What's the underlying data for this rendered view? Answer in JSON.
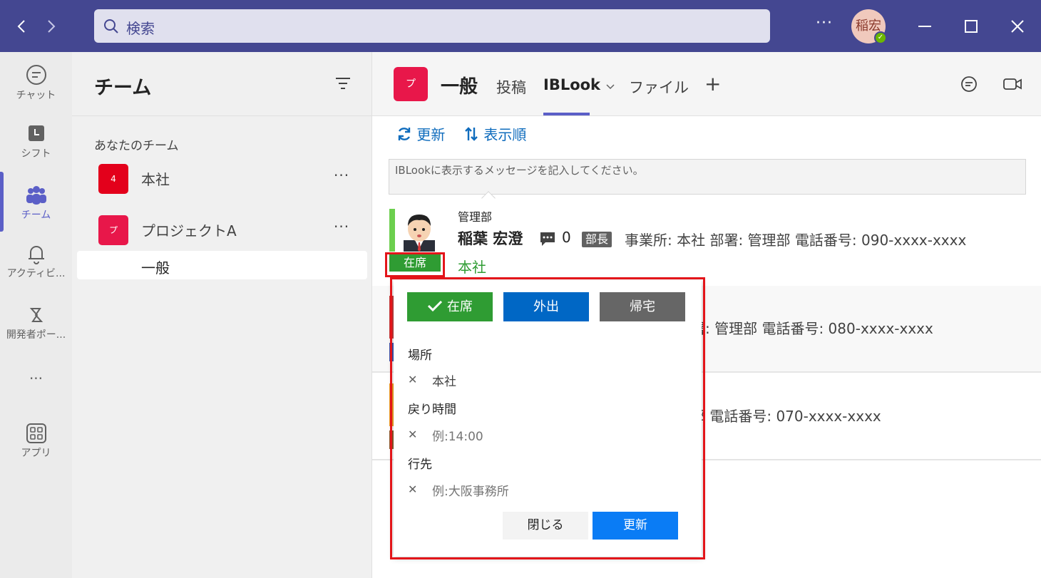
{
  "titlebar": {
    "back_icon": "chevron-left-icon",
    "forward_icon": "chevron-right-icon",
    "search_placeholder": "検索",
    "more_label": "···",
    "avatar_initials": "稲宏",
    "presence_status": "available"
  },
  "rail": {
    "items": [
      {
        "label": "チャット",
        "icon": "chat-icon"
      },
      {
        "label": "シフト",
        "icon": "shifts-icon"
      },
      {
        "label": "チーム",
        "icon": "teams-icon",
        "active": true
      },
      {
        "label": "アクティビ...",
        "icon": "bell-icon"
      },
      {
        "label": "開発者ポー...",
        "icon": "developer-portal-icon"
      },
      {
        "label": "···",
        "icon": "more-icon"
      },
      {
        "label": "アプリ",
        "icon": "apps-icon"
      }
    ]
  },
  "teams_panel": {
    "title": "チーム",
    "section": "あなたのチーム",
    "teams": [
      {
        "name": "本社",
        "tile": "4",
        "color": "#e3001b"
      },
      {
        "name": "プロジェクトA",
        "tile": "プ",
        "color": "#e8174a"
      }
    ],
    "channel": "一般",
    "more": "···"
  },
  "main": {
    "channel_tile": "プ",
    "channel_title": "一般",
    "tabs": [
      "投稿",
      "IBLook",
      "ファイル"
    ],
    "add_tab": "+",
    "toolbar": {
      "refresh": "更新",
      "sort": "表示順"
    },
    "message_placeholder": "IBLookに表示するメッセージを記入してください。",
    "person": {
      "dept": "管理部",
      "name": "稲葉 宏澄",
      "comment_count": "0",
      "title_badge": "部長",
      "info": "事業所: 本社  部署: 管理部  電話番号: 090-xxxx-xxxx",
      "location": "本社",
      "status": "在席"
    },
    "row2_fragment": "署: 管理部  電話番号: 080-xxxx-xxxx",
    "row3_fragment": "部  電話番号: 070-xxxx-xxxx"
  },
  "popup": {
    "status_buttons": [
      {
        "label": "在席",
        "color": "#2f9c33",
        "selected": true
      },
      {
        "label": "外出",
        "color": "#0067c5"
      },
      {
        "label": "帰宅",
        "color": "#666666"
      }
    ],
    "location_label": "場所",
    "location_value": "本社",
    "return_label": "戻り時間",
    "return_placeholder": "例:14:00",
    "destination_label": "行先",
    "destination_placeholder": "例:大阪事務所",
    "close_label": "閉じる",
    "update_label": "更新"
  },
  "colors": {
    "brand": "#444791",
    "accent": "#5b5fc7",
    "highlight": "#e3151a"
  }
}
